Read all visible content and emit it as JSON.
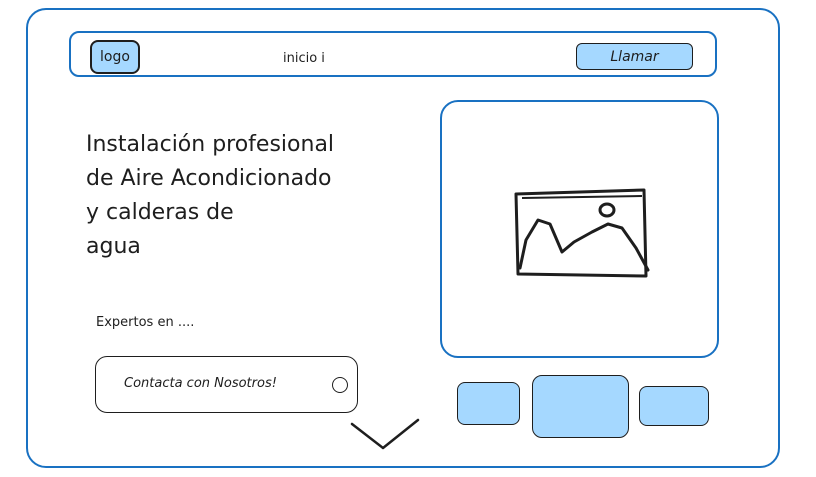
{
  "header": {
    "logo_label": "logo",
    "nav_link": "inicio i",
    "call_button_label": "Llamar"
  },
  "hero": {
    "title": "Instalación profesional\nde Aire Acondicionado\ny calderas de\nagua",
    "subtitle": "Expertos en ....",
    "cta_label": "Contacta con Nosotros!"
  },
  "media": {
    "main_image_icon": "image-placeholder-icon",
    "thumbnails": [
      "thumbnail-1",
      "thumbnail-2",
      "thumbnail-3"
    ]
  },
  "colors": {
    "accent": "#1971c2",
    "fill": "#a5d8ff",
    "stroke": "#1e1e1e"
  }
}
